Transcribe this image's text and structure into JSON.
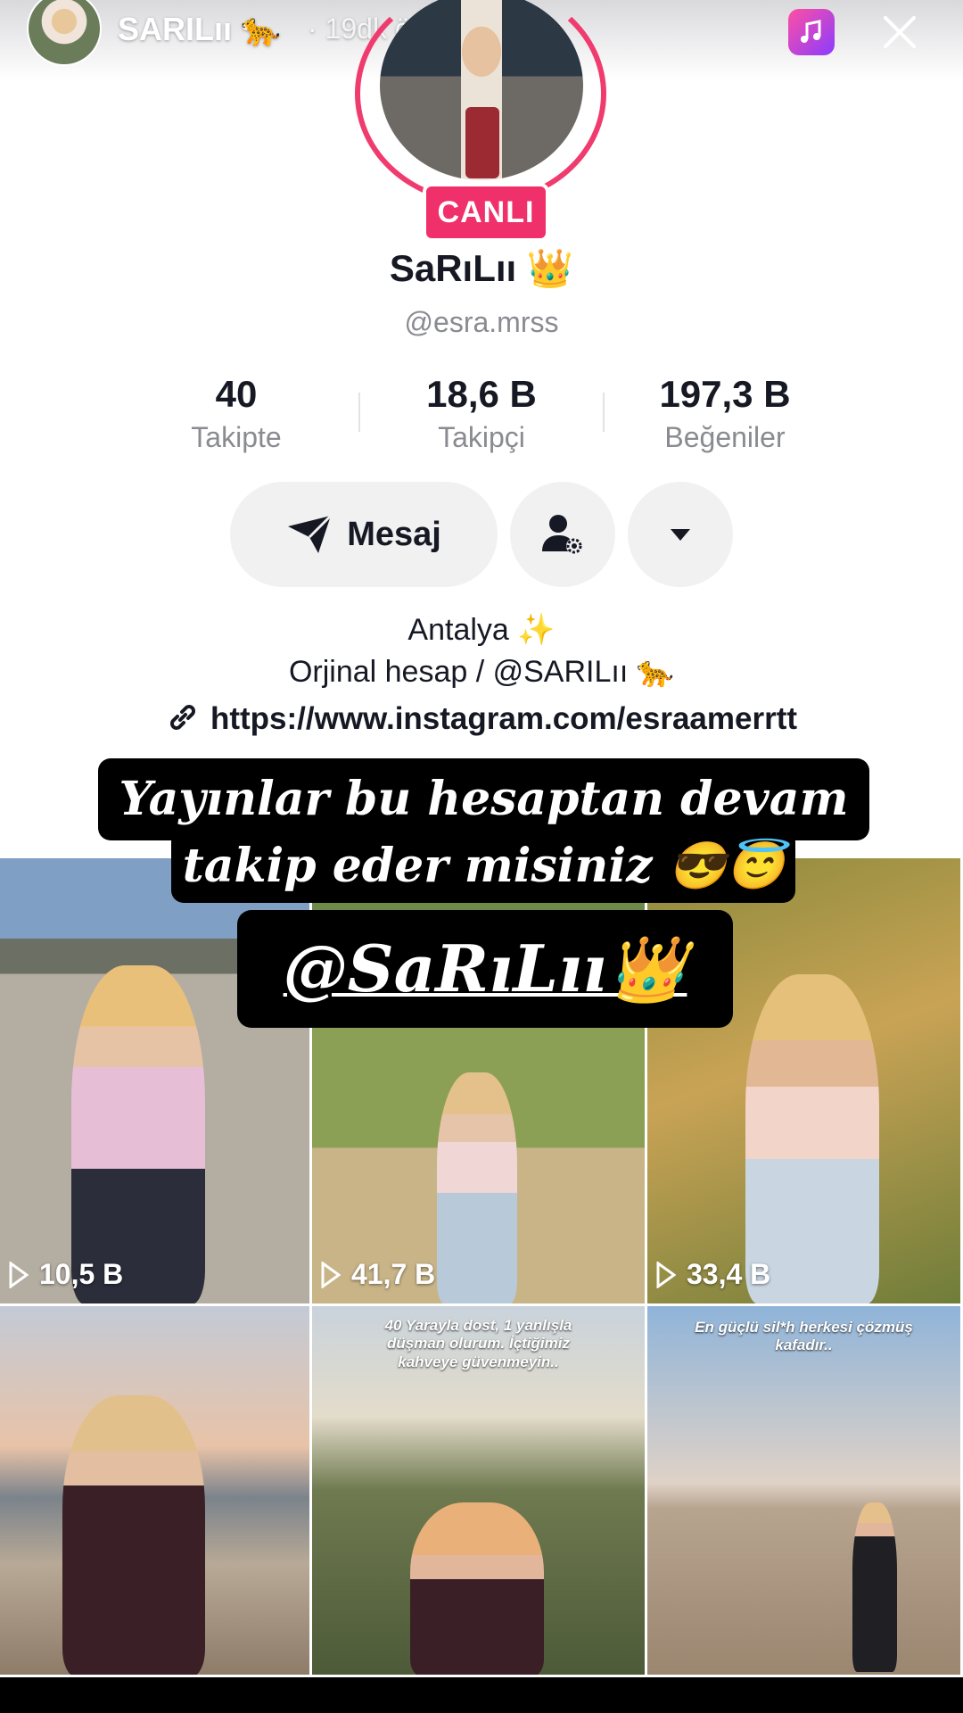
{
  "story": {
    "username": "SARILıı 🐆",
    "time": "· 19dk önce"
  },
  "profile": {
    "live_badge": "CANLI",
    "display_name": "SaRıLıı 👑",
    "username": "@esra.mrss"
  },
  "stats": [
    {
      "value": "40",
      "label": "Takipte"
    },
    {
      "value": "18,6 B",
      "label": "Takipçi"
    },
    {
      "value": "197,3 B",
      "label": "Beğeniler"
    }
  ],
  "actions": {
    "message_label": "Mesaj"
  },
  "bio": {
    "line1": "Antalya ✨",
    "line2": "Orjinal hesap / @SARILıı 🐆",
    "link": "https://www.instagram.com/esraamerrtt"
  },
  "overlay": {
    "line1": "Yayınlar bu hesaptan devam",
    "line2": "takip eder misiniz 😎😇",
    "mention": "@SaRıLıı👑"
  },
  "videos": [
    {
      "views": "10,5 B"
    },
    {
      "views": "41,7 B"
    },
    {
      "views": "33,4 B"
    },
    {
      "caption": ""
    },
    {
      "caption": "40 Yarayla dost, 1 yanlışla düşman olurum. İçtiğimiz kahveye güvenmeyin.."
    },
    {
      "caption": "En güçlü sil*h herkesi çözmüş kafadır.."
    }
  ],
  "colors": {
    "accent": "#f0306a",
    "ring": "#f03b6e"
  }
}
